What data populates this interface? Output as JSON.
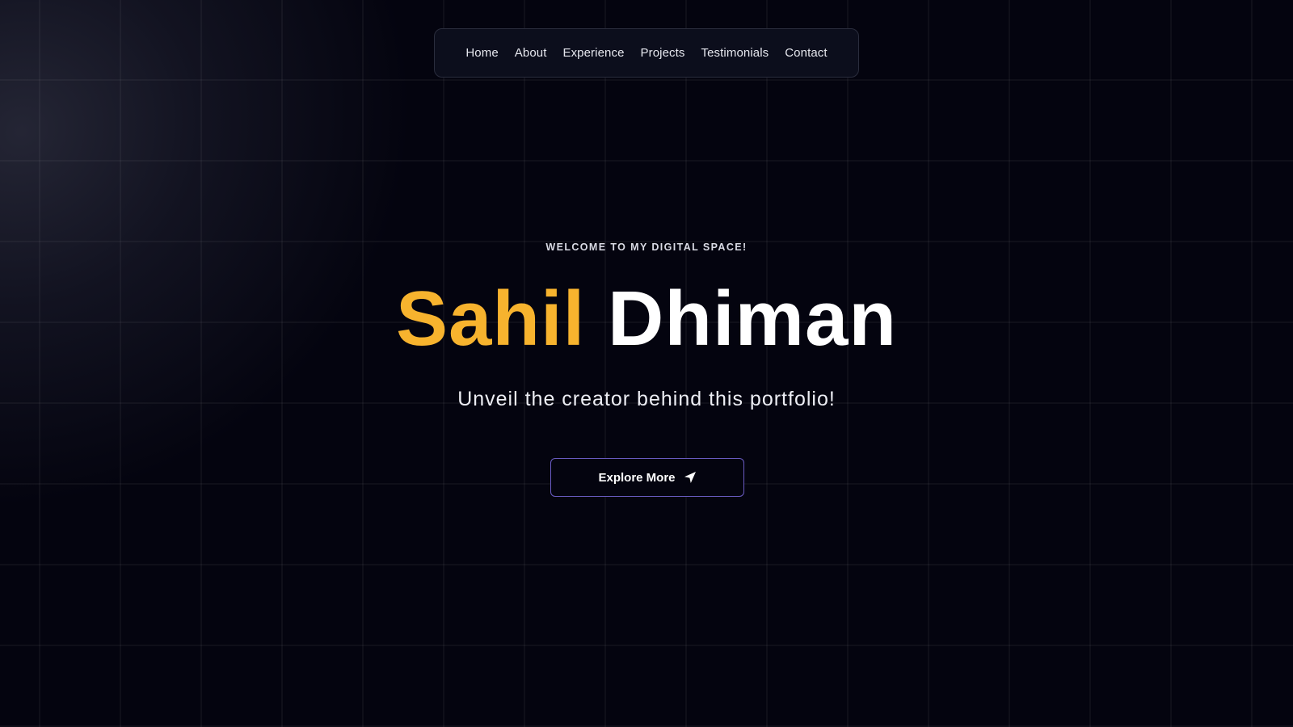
{
  "nav": {
    "items": [
      {
        "label": "Home"
      },
      {
        "label": "About"
      },
      {
        "label": "Experience"
      },
      {
        "label": "Projects"
      },
      {
        "label": "Testimonials"
      },
      {
        "label": "Contact"
      }
    ]
  },
  "hero": {
    "eyebrow": "WELCOME TO MY DIGITAL SPACE!",
    "first_name": "Sahil",
    "last_name": "Dhiman",
    "tagline": "Unveil the creator behind this portfolio!",
    "cta": {
      "label": "Explore More",
      "icon": "send-icon"
    }
  },
  "colors": {
    "background": "#04040f",
    "accent": "#f7b32e",
    "button_border": "#6a5cc4"
  }
}
